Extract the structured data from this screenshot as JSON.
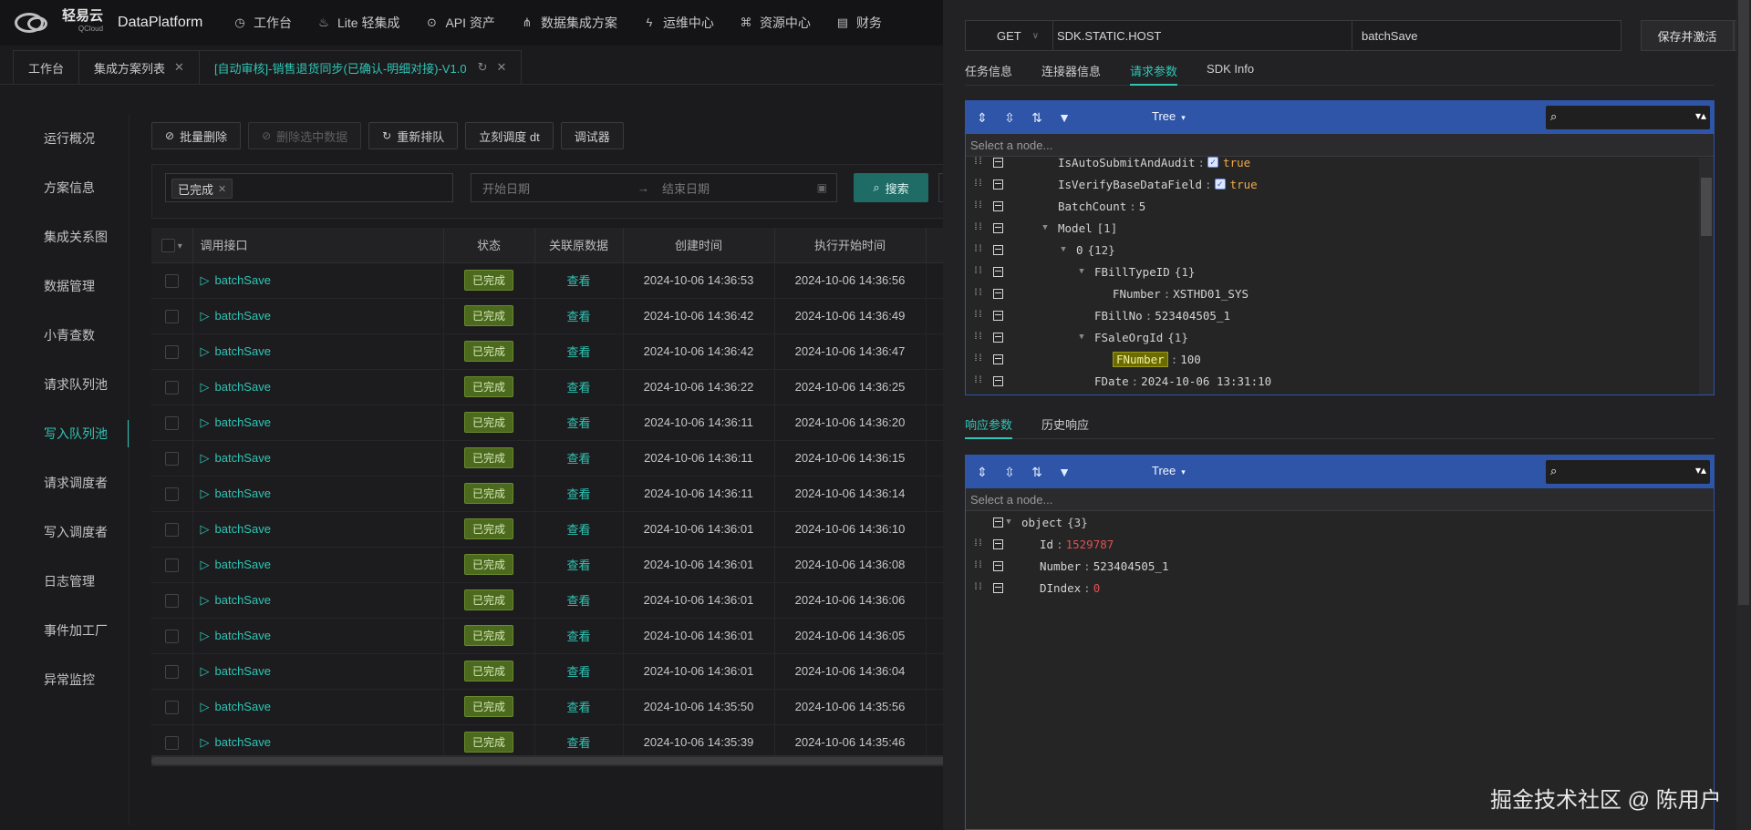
{
  "topnav": {
    "logo_cn": "轻易云",
    "logo_sub": "QCloud",
    "logo_en": "DataPlatform",
    "items": [
      {
        "label": "工作台",
        "icon": "clock-icon"
      },
      {
        "label": "Lite 轻集成",
        "icon": "cup-icon"
      },
      {
        "label": "API 资产",
        "icon": "compass-icon"
      },
      {
        "label": "数据集成方案",
        "icon": "share-icon"
      },
      {
        "label": "运维中心",
        "icon": "bolt-icon"
      },
      {
        "label": "资源中心",
        "icon": "network-icon"
      },
      {
        "label": "财务",
        "icon": "wallet-icon"
      }
    ]
  },
  "tabs": [
    {
      "label": "工作台",
      "active": false
    },
    {
      "label": "集成方案列表",
      "active": false
    },
    {
      "label": "[自动审核]-销售退货同步(已确认-明细对接)-V1.0",
      "active": true
    }
  ],
  "leftmenu": [
    {
      "label": "运行概况",
      "active": false
    },
    {
      "label": "方案信息",
      "active": false
    },
    {
      "label": "集成关系图",
      "active": false
    },
    {
      "label": "数据管理",
      "active": false
    },
    {
      "label": "小青查数",
      "active": false
    },
    {
      "label": "请求队列池",
      "active": false
    },
    {
      "label": "写入队列池",
      "active": true
    },
    {
      "label": "请求调度者",
      "active": false
    },
    {
      "label": "写入调度者",
      "active": false
    },
    {
      "label": "日志管理",
      "active": false
    },
    {
      "label": "事件加工厂",
      "active": false
    },
    {
      "label": "异常监控",
      "active": false
    }
  ],
  "toolbar": {
    "batch_delete": "批量删除",
    "delete_selected": "删除选中数据",
    "requeue": "重新排队",
    "dispatch_now": "立刻调度 dt",
    "debugger": "调试器"
  },
  "filter": {
    "status_tag": "已完成",
    "start_placeholder": "开始日期",
    "end_placeholder": "结束日期",
    "search_label": "搜索"
  },
  "table": {
    "headers": [
      "调用接口",
      "状态",
      "关联原数据",
      "创建时间",
      "执行开始时间"
    ],
    "rows": [
      {
        "api": "batchSave",
        "status": "已完成",
        "link": "查看",
        "created": "2024-10-06 14:36:53",
        "started": "2024-10-06 14:36:56"
      },
      {
        "api": "batchSave",
        "status": "已完成",
        "link": "查看",
        "created": "2024-10-06 14:36:42",
        "started": "2024-10-06 14:36:49"
      },
      {
        "api": "batchSave",
        "status": "已完成",
        "link": "查看",
        "created": "2024-10-06 14:36:42",
        "started": "2024-10-06 14:36:47"
      },
      {
        "api": "batchSave",
        "status": "已完成",
        "link": "查看",
        "created": "2024-10-06 14:36:22",
        "started": "2024-10-06 14:36:25"
      },
      {
        "api": "batchSave",
        "status": "已完成",
        "link": "查看",
        "created": "2024-10-06 14:36:11",
        "started": "2024-10-06 14:36:20"
      },
      {
        "api": "batchSave",
        "status": "已完成",
        "link": "查看",
        "created": "2024-10-06 14:36:11",
        "started": "2024-10-06 14:36:15"
      },
      {
        "api": "batchSave",
        "status": "已完成",
        "link": "查看",
        "created": "2024-10-06 14:36:11",
        "started": "2024-10-06 14:36:14"
      },
      {
        "api": "batchSave",
        "status": "已完成",
        "link": "查看",
        "created": "2024-10-06 14:36:01",
        "started": "2024-10-06 14:36:10"
      },
      {
        "api": "batchSave",
        "status": "已完成",
        "link": "查看",
        "created": "2024-10-06 14:36:01",
        "started": "2024-10-06 14:36:08"
      },
      {
        "api": "batchSave",
        "status": "已完成",
        "link": "查看",
        "created": "2024-10-06 14:36:01",
        "started": "2024-10-06 14:36:06"
      },
      {
        "api": "batchSave",
        "status": "已完成",
        "link": "查看",
        "created": "2024-10-06 14:36:01",
        "started": "2024-10-06 14:36:05"
      },
      {
        "api": "batchSave",
        "status": "已完成",
        "link": "查看",
        "created": "2024-10-06 14:36:01",
        "started": "2024-10-06 14:36:04"
      },
      {
        "api": "batchSave",
        "status": "已完成",
        "link": "查看",
        "created": "2024-10-06 14:35:50",
        "started": "2024-10-06 14:35:56"
      },
      {
        "api": "batchSave",
        "status": "已完成",
        "link": "查看",
        "created": "2024-10-06 14:35:39",
        "started": "2024-10-06 14:35:46"
      }
    ]
  },
  "panel": {
    "method": "GET",
    "host": "SDK.STATIC.HOST",
    "action": "batchSave",
    "save_label": "保存并激活",
    "more_label": "···",
    "tabs": [
      {
        "label": "任务信息",
        "active": false
      },
      {
        "label": "连接器信息",
        "active": false
      },
      {
        "label": "请求参数",
        "active": true
      },
      {
        "label": "SDK Info",
        "active": false
      }
    ],
    "resp_tabs": [
      {
        "label": "响应参数",
        "active": true
      },
      {
        "label": "历史响应",
        "active": false
      }
    ],
    "editor_mode": "Tree",
    "node_placeholder": "Select a node...",
    "request_tree": [
      {
        "indent": 0,
        "key": "IsAutoSubmitAndAudit",
        "value": "true",
        "kind": "bool"
      },
      {
        "indent": 0,
        "key": "IsVerifyBaseDataField",
        "value": "true",
        "kind": "bool"
      },
      {
        "indent": 0,
        "key": "BatchCount",
        "value": "5",
        "kind": "num"
      },
      {
        "indent": 0,
        "key": "Model",
        "count": "[1]",
        "kind": "array",
        "expanded": true
      },
      {
        "indent": 1,
        "key": "0",
        "count": "{12}",
        "kind": "object",
        "expanded": true
      },
      {
        "indent": 2,
        "key": "FBillTypeID",
        "count": "{1}",
        "kind": "object",
        "expanded": true
      },
      {
        "indent": 3,
        "key": "FNumber",
        "value": "XSTHD01_SYS",
        "kind": "str"
      },
      {
        "indent": 2,
        "key": "FBillNo",
        "value": "523404505_1",
        "kind": "str"
      },
      {
        "indent": 2,
        "key": "FSaleOrgId",
        "count": "{1}",
        "kind": "object",
        "expanded": true
      },
      {
        "indent": 3,
        "key": "FNumber",
        "value": "100",
        "kind": "num",
        "highlight": true
      },
      {
        "indent": 2,
        "key": "FDate",
        "value": "2024-10-06 13:31:10",
        "kind": "str"
      }
    ],
    "response_tree": [
      {
        "indent": 0,
        "key": "object",
        "count": "{3}",
        "kind": "root",
        "expanded": true
      },
      {
        "indent": 1,
        "key": "Id",
        "value": "1529787",
        "kind": "red"
      },
      {
        "indent": 1,
        "key": "Number",
        "value": "523404505_1",
        "kind": "str"
      },
      {
        "indent": 1,
        "key": "DIndex",
        "value": "0",
        "kind": "red"
      }
    ]
  },
  "watermark_site": "掘金技术社区 @ 陈用户"
}
